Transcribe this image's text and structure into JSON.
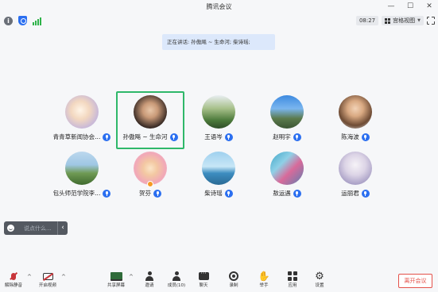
{
  "window": {
    "title": "腾讯会议"
  },
  "infobar": {
    "timer": "08:27",
    "view_label": "宫格视图"
  },
  "speaking": {
    "text": "正在讲话: 孙傲飚 ~ 生命河; 柴诗瑶;"
  },
  "participants": [
    {
      "name": "青青草新闻协会...",
      "mic": true,
      "av": "a1"
    },
    {
      "name": "孙傲飚 ~ 生命河",
      "mic": true,
      "av": "a2",
      "active": true
    },
    {
      "name": "王语岑",
      "mic": true,
      "av": "a3"
    },
    {
      "name": "赵明宇",
      "mic": true,
      "av": "a4"
    },
    {
      "name": "陈海波",
      "mic": true,
      "av": "a5"
    },
    {
      "name": "包头师范学院李...",
      "mic": true,
      "av": "a6"
    },
    {
      "name": "贺芬",
      "mic": true,
      "av": "a7",
      "host": true
    },
    {
      "name": "柴诗瑶",
      "mic": true,
      "av": "a8"
    },
    {
      "name": "敖运遇",
      "mic": true,
      "av": "a9"
    },
    {
      "name": "运丽君",
      "mic": true,
      "av": "a10"
    }
  ],
  "chat": {
    "placeholder": "说点什么..."
  },
  "toolbar": {
    "unmute": "解除静音",
    "start_video": "开启视频",
    "share_screen": "共享屏幕",
    "invite": "邀请",
    "members": "成员(10)",
    "chat": "聊天",
    "record": "录制",
    "raise_hand": "举手",
    "apps": "应用",
    "settings": "设置"
  },
  "leave": {
    "label": "离开会议"
  },
  "colors": {
    "accent": "#2b6ff0",
    "active_border": "#2fb86a",
    "leave": "#e4514a"
  }
}
